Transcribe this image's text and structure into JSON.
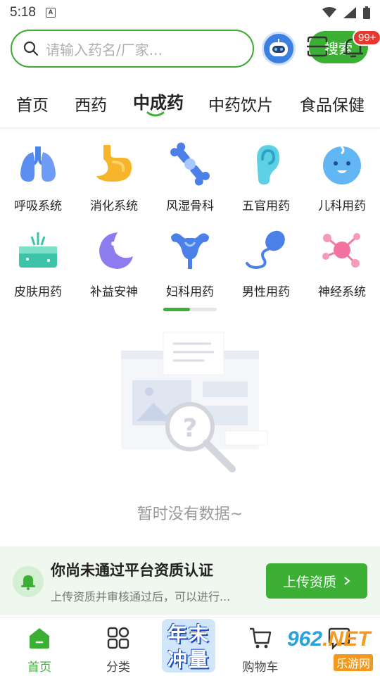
{
  "status_bar": {
    "time": "5:18",
    "notif_badge": "A"
  },
  "search": {
    "placeholder": "请输入药名/厂家...",
    "button": "搜索"
  },
  "header": {
    "message_badge": "99+"
  },
  "tabs": [
    {
      "label": "首页"
    },
    {
      "label": "西药"
    },
    {
      "label": "中成药",
      "active": true
    },
    {
      "label": "中药饮片"
    },
    {
      "label": "食品保健"
    }
  ],
  "categories": [
    {
      "label": "呼吸系统",
      "icon": "lungs-icon"
    },
    {
      "label": "消化系统",
      "icon": "stomach-icon"
    },
    {
      "label": "风湿骨科",
      "icon": "bone-joint-icon"
    },
    {
      "label": "五官用药",
      "icon": "ear-icon"
    },
    {
      "label": "儿科用药",
      "icon": "baby-face-icon"
    },
    {
      "label": "皮肤用药",
      "icon": "skin-icon"
    },
    {
      "label": "补益安神",
      "icon": "moon-icon"
    },
    {
      "label": "妇科用药",
      "icon": "uterus-icon"
    },
    {
      "label": "男性用药",
      "icon": "sperm-icon"
    },
    {
      "label": "神经系统",
      "icon": "neuron-icon"
    }
  ],
  "category_pager": {
    "page": 1,
    "total": 2
  },
  "empty_state": {
    "text": "暂时没有数据~"
  },
  "certification": {
    "title": "你尚未通过平台资质认证",
    "subtitle": "上传资质并审核通过后，可以进行...",
    "button": "上传资质"
  },
  "bottom_nav": [
    {
      "label": "首页",
      "icon": "home-icon",
      "active": true
    },
    {
      "label": "分类",
      "icon": "category-grid-icon"
    },
    {
      "label": "年末冲量",
      "icon": "promo-banner-icon"
    },
    {
      "label": "购物车",
      "icon": "cart-icon"
    },
    {
      "label": "",
      "icon": "chat-icon"
    }
  ],
  "promo": {
    "line1": "年末",
    "line2": "冲量"
  },
  "watermark": {
    "text_a": "962",
    "text_b": ".NET",
    "text_c": "乐游网"
  },
  "colors": {
    "accent": "#3cb034",
    "badge": "#e8372c",
    "promo_blue": "#1b4fc4"
  }
}
